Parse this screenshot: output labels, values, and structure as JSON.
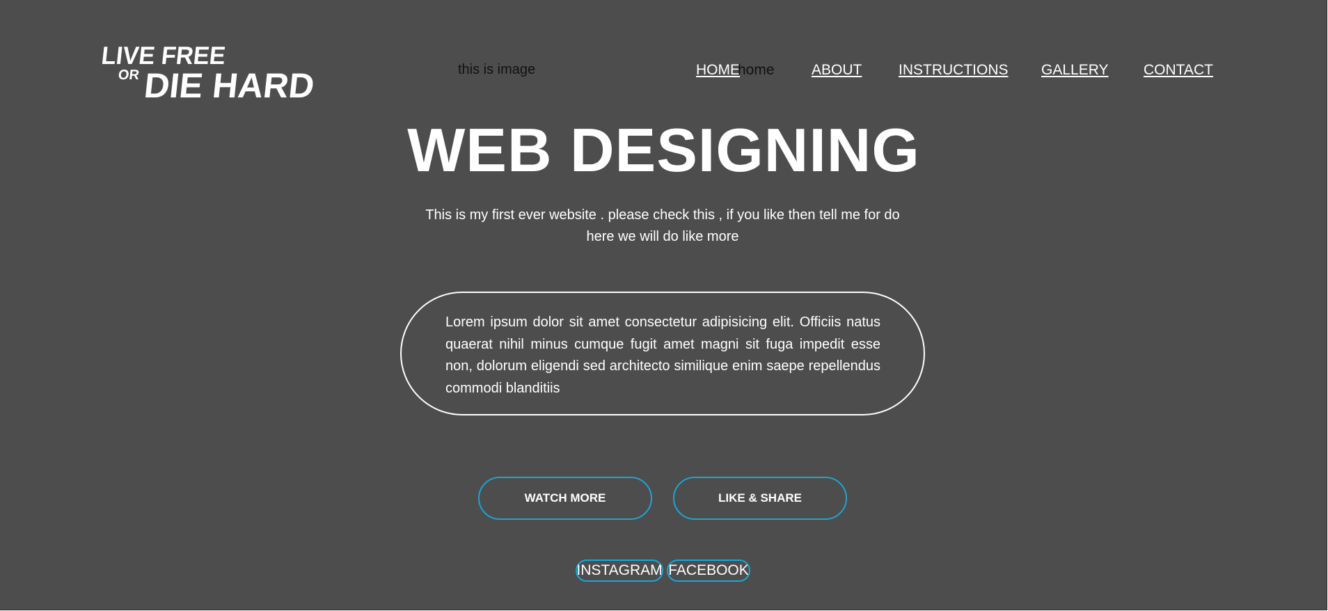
{
  "logo": {
    "line1": "LIVE FREE",
    "line2_small": "OR",
    "line2_big": "DIE HARD"
  },
  "header": {
    "image_alt_text": "this is image",
    "home_overlay_text": "home"
  },
  "nav": {
    "home": "HOME",
    "about": "ABOUT",
    "instructions": "INSTRUCTIONS",
    "gallery": "GALLERY",
    "contact": "CONTACT"
  },
  "hero": {
    "title": "WEB DESIGNING",
    "subtitle": "This is my first ever website . please check this , if you like then tell me for do here we will do like more"
  },
  "lorem": {
    "text": "Lorem ipsum dolor sit amet consectetur adipisicing elit. Officiis natus quaerat nihil minus cumque fugit amet magni sit fuga impedit esse non, dolorum eligendi sed architecto similique enim saepe repellendus commodi blanditiis"
  },
  "buttons": {
    "watch_more": "WATCH MORE",
    "like_share": "LIKE & SHARE"
  },
  "social": {
    "instagram": "INSTAGRAM",
    "facebook": "FACEBOOK"
  },
  "colors": {
    "background": "#4d4d4d",
    "accent": "#1aa6d6",
    "text": "#ffffff"
  }
}
